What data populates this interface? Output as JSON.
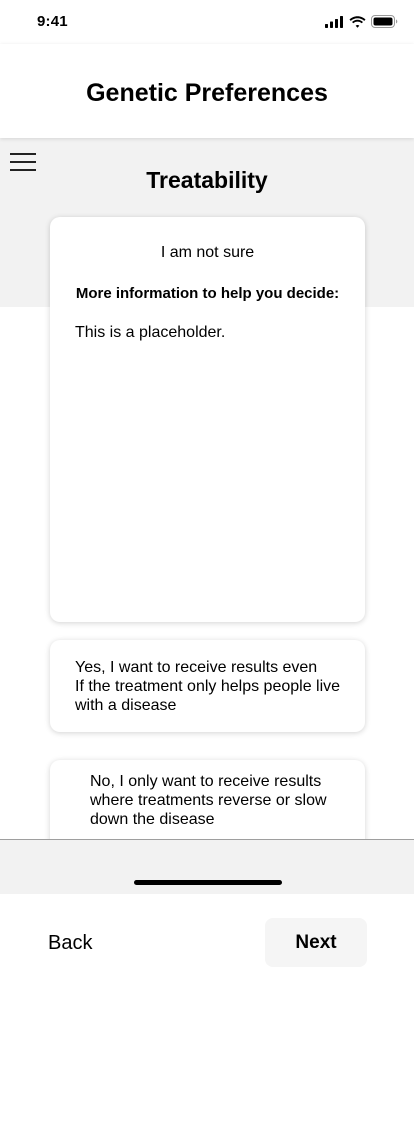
{
  "status_bar": {
    "time": "9:41",
    "icons": [
      "signal-icon",
      "wifi-icon",
      "battery-icon"
    ]
  },
  "header": {
    "title": "Genetic Preferences"
  },
  "menu": {
    "icon": "hamburger-menu-icon"
  },
  "section": {
    "title": "Treatability"
  },
  "main_card": {
    "heading": "I am not sure",
    "subheading": "More information to help you decide:",
    "body": "This is a placeholder."
  },
  "options": [
    {
      "lines": [
        "Yes, I want to receive results even",
        "If the treatment only helps people live",
        "with a disease"
      ]
    },
    {
      "lines": [
        "No, I only want to receive results",
        "where treatments reverse or slow",
        "down the disease"
      ]
    }
  ],
  "footer": {
    "back_label": "Back",
    "next_label": "Next"
  },
  "colors": {
    "background": "#ffffff",
    "band": "#f2f2f2",
    "text": "#000000",
    "next_button_bg": "#f5f5f5"
  }
}
